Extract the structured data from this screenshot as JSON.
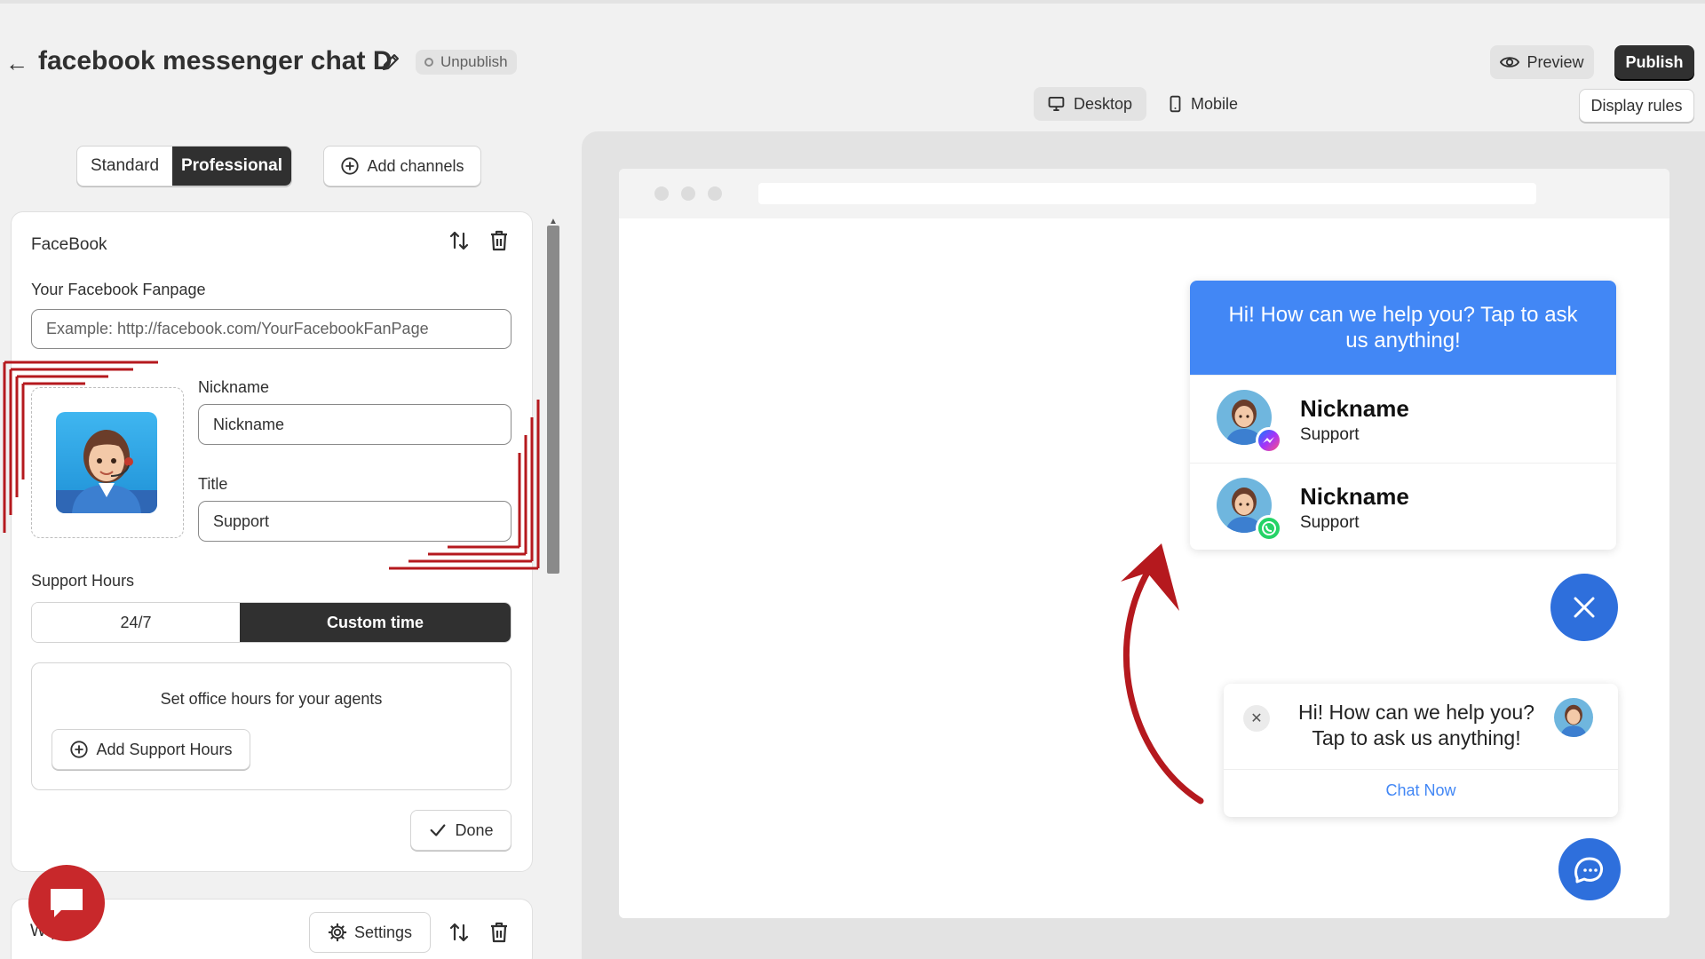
{
  "header": {
    "title": "facebook messenger chat D",
    "status": "Unpublish",
    "preview_label": "Preview",
    "publish_label": "Publish",
    "display_rules_label": "Display rules"
  },
  "device_tabs": {
    "desktop": "Desktop",
    "mobile": "Mobile",
    "selected": "Desktop"
  },
  "mode_toggle": {
    "standard": "Standard",
    "professional": "Professional",
    "selected": "Professional"
  },
  "add_channels_label": "Add channels",
  "channel_facebook": {
    "name": "FaceBook",
    "fanpage_label": "Your Facebook Fanpage",
    "fanpage_placeholder": "Example: http://facebook.com/YourFacebookFanPage",
    "nickname_label": "Nickname",
    "nickname_value": "Nickname",
    "title_label": "Title",
    "title_value": "Support",
    "support_hours_label": "Support Hours",
    "hours_option_247": "24/7",
    "hours_option_custom": "Custom time",
    "hours_selected": "Custom time",
    "office_hours_text": "Set office hours for your agents",
    "add_hours_label": "Add Support Hours",
    "done_label": "Done"
  },
  "channel_whatsapp": {
    "name": "W  pp",
    "settings_label": "Settings"
  },
  "preview_widget": {
    "header_text": "Hi! How can we help you? Tap to ask us anything!",
    "agents": [
      {
        "name": "Nickname",
        "title": "Support",
        "channel_icon": "messenger-icon"
      },
      {
        "name": "Nickname",
        "title": "Support",
        "channel_icon": "whatsapp-icon"
      }
    ],
    "greeting_text": "Hi! How can we help you? Tap to ask us anything!",
    "chat_now_label": "Chat Now"
  },
  "colors": {
    "primary_blue": "#4287f5",
    "fab_blue": "#2e6fdc",
    "dark": "#303030",
    "annotation_red": "#b5191e"
  }
}
